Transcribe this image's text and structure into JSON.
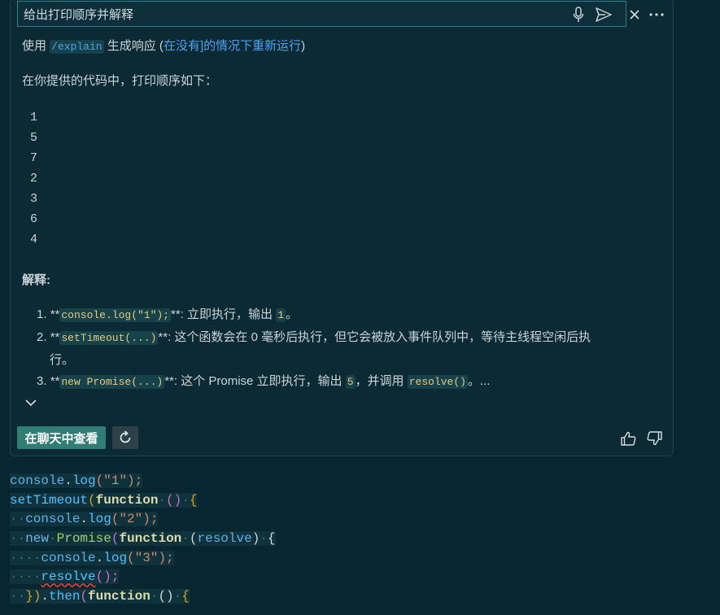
{
  "prompt": {
    "value": "给出打印顺序并解释",
    "placeholder": "给出打印顺序并解释"
  },
  "usage": {
    "prefix": "使用 ",
    "command": "/explain",
    "suffix": " 生成响应 (",
    "link": "在没有]的情况下重新运行",
    "close": ")"
  },
  "intro": "在你提供的代码中，打印顺序如下：",
  "order": [
    "1",
    "5",
    "7",
    "2",
    "3",
    "6",
    "4"
  ],
  "explain_heading": "解释:",
  "items": [
    {
      "num": "1.",
      "pre": "**",
      "code": "console.log(\"1\");",
      "post": "**: 立即执行，输出 ",
      "code2": "1",
      "tail": "。"
    },
    {
      "num": "2.",
      "pre": "**",
      "code": "setTimeout(...)",
      "post": "**: 这个函数会在 0 毫秒后执行，但它会被放入事件队列中，等待主线程空闲后执",
      "cont": "行。"
    },
    {
      "num": "3.",
      "pre": "**",
      "code": "new Promise(...)",
      "post": "**: 这个 Promise 立即执行，输出 ",
      "code2": "5",
      "mid": "，并调用 ",
      "code3": "resolve()",
      "tail": "。..."
    }
  ],
  "actions": {
    "view_in_chat": "在聊天中查看"
  },
  "icons": {
    "mic": "microphone-icon",
    "send": "send-icon",
    "close": "close-icon",
    "more": "more-icon",
    "expand": "chevron-down-icon",
    "refresh": "refresh-icon",
    "up": "thumbs-up-icon",
    "down": "thumbs-down-icon"
  },
  "colors": {
    "accent": "#2f7d74",
    "link": "#4aa3f0",
    "background": "#082630"
  },
  "code": [
    {
      "indent": "",
      "parts": [
        "console",
        ".",
        "log",
        "(\"1\");"
      ]
    },
    {
      "indent": "",
      "parts": [
        "setTimeout",
        "(",
        "function",
        " ",
        "()",
        " ",
        "{"
      ]
    },
    {
      "indent": "··",
      "parts": [
        "console",
        ".",
        "log",
        "(\"2\");"
      ]
    },
    {
      "indent": "··",
      "parts": [
        "new",
        " ",
        "Promise",
        "(",
        "function",
        " ",
        "(",
        "resolve",
        ")",
        " ",
        "{"
      ]
    },
    {
      "indent": "····",
      "parts": [
        "console",
        ".",
        "log",
        "(\"3\");"
      ]
    },
    {
      "indent": "····",
      "parts": [
        "resolve",
        "();"
      ]
    },
    {
      "indent": "··",
      "parts": [
        "})",
        ".",
        "then",
        "(",
        "function",
        " ",
        "()",
        " ",
        "{"
      ]
    }
  ]
}
